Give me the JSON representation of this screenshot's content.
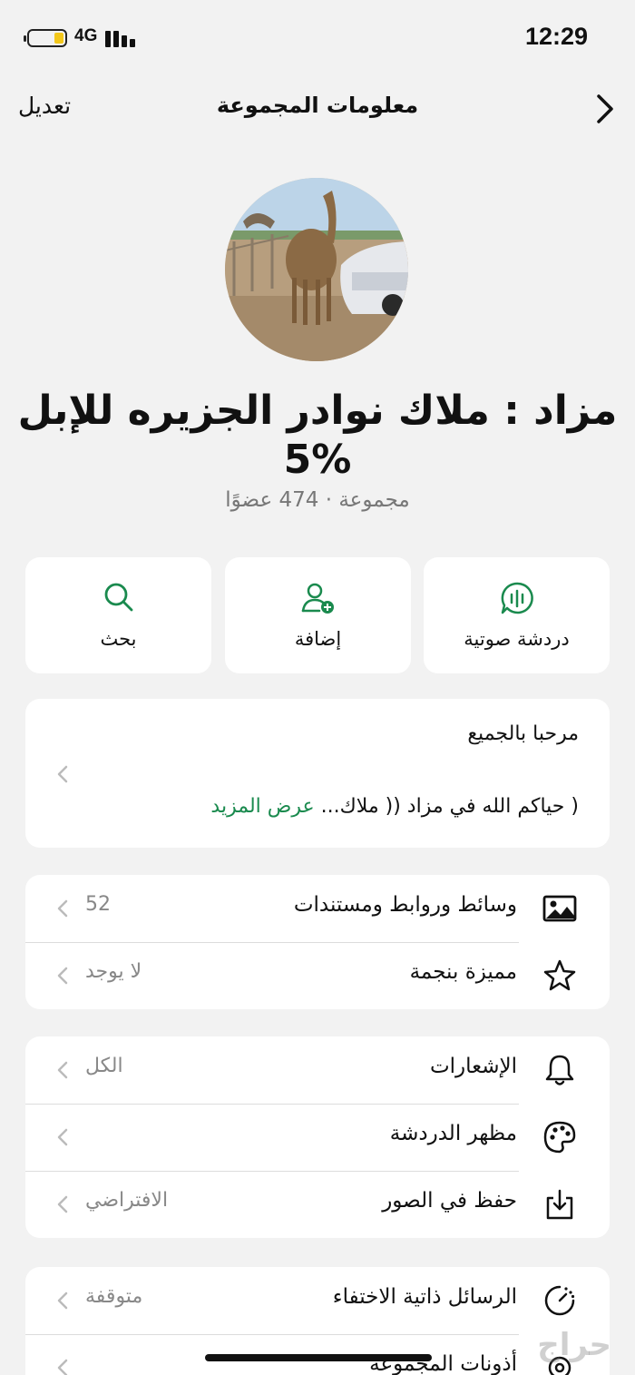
{
  "status": {
    "network": "4G",
    "time": "12:29"
  },
  "nav": {
    "edit": "تعديل",
    "title": "معلومات المجموعة"
  },
  "group": {
    "name_line1": "مزاد : ملاك نوادر الجزيره للإبل",
    "name_line2": "5%",
    "meta": "مجموعة · 474 عضوًا"
  },
  "actions": [
    {
      "label": "دردشة صوتية",
      "icon": "voice-chat-icon"
    },
    {
      "label": "إضافة",
      "icon": "add-user-icon"
    },
    {
      "label": "بحث",
      "icon": "search-icon"
    }
  ],
  "description": {
    "title": "مرحبا بالجميع",
    "body": "( حياكم الله في مزاد (( ملاك... ",
    "more": "عرض المزيد"
  },
  "section1": [
    {
      "label": "وسائط وروابط ومستندات",
      "value": "52",
      "icon": "photo-icon"
    },
    {
      "label": "مميزة بنجمة",
      "value": "لا يوجد",
      "icon": "star-icon"
    }
  ],
  "section2": [
    {
      "label": "الإشعارات",
      "value": "الكل",
      "icon": "bell-icon"
    },
    {
      "label": "مظهر الدردشة",
      "value": "",
      "icon": "palette-icon"
    },
    {
      "label": "حفظ في الصور",
      "value": "الافتراضي",
      "icon": "save-download-icon"
    }
  ],
  "section3": [
    {
      "label": "الرسائل ذاتية الاختفاء",
      "value": "متوقفة",
      "icon": "timer-icon"
    },
    {
      "label": "أذونات المجموعة",
      "value": "",
      "icon": "settings-icon"
    }
  ],
  "watermark": "حراج",
  "colors": {
    "accent": "#1a8a4e",
    "background": "#f2f2f2",
    "card": "#ffffff"
  }
}
